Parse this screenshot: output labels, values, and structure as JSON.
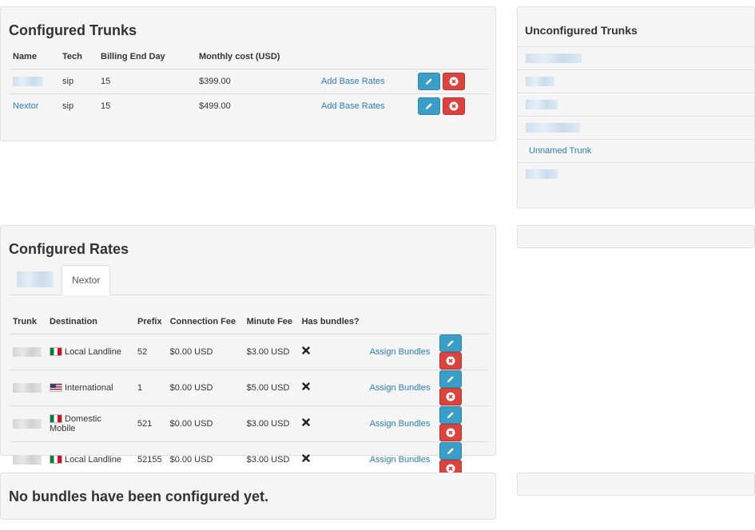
{
  "configured_trunks": {
    "title": "Configured Trunks",
    "columns": [
      "Name",
      "Tech",
      "Billing End Day",
      "Monthly cost (USD)"
    ],
    "rows": [
      {
        "name": "",
        "tech": "sip",
        "billing_end_day": "15",
        "monthly_cost": "$399.00",
        "action": "Add Base Rates"
      },
      {
        "name": "Nextor",
        "tech": "sip",
        "billing_end_day": "15",
        "monthly_cost": "$499.00",
        "action": "Add Base Rates"
      }
    ]
  },
  "unconfigured_trunks": {
    "title": "Unconfigured Trunks",
    "items": [
      "",
      "",
      "",
      "",
      "Unnamed Trunk",
      ""
    ]
  },
  "configured_rates": {
    "title": "Configured Rates",
    "tabs": [
      "",
      "Nextor"
    ],
    "active_tab": "Nextor",
    "columns": [
      "Trunk",
      "Destination",
      "Prefix",
      "Connection Fee",
      "Minute Fee",
      "Has bundles?"
    ],
    "rows": [
      {
        "trunk": "",
        "flag": "mx",
        "destination": "Local Landline",
        "prefix": "52",
        "connection_fee": "$0.00 USD",
        "minute_fee": "$3.00 USD",
        "has_bundles": "✖",
        "action": "Assign Bundles"
      },
      {
        "trunk": "",
        "flag": "us",
        "destination": "International",
        "prefix": "1",
        "connection_fee": "$0.00 USD",
        "minute_fee": "$5.00 USD",
        "has_bundles": "✖",
        "action": "Assign Bundles"
      },
      {
        "trunk": "",
        "flag": "mx",
        "destination": "Domestic Mobile",
        "prefix": "521",
        "connection_fee": "$0.00 USD",
        "minute_fee": "$3.00 USD",
        "has_bundles": "✖",
        "action": "Assign Bundles"
      },
      {
        "trunk": "",
        "flag": "mx",
        "destination": "Local Landline",
        "prefix": "52155",
        "connection_fee": "$0.00 USD",
        "minute_fee": "$3.00 USD",
        "has_bundles": "✖",
        "action": "Assign Bundles"
      }
    ]
  },
  "bundles": {
    "empty_message": "No bundles have been configured yet."
  },
  "colors": {
    "link": "#2a7db8",
    "edit_button": "#3a9ec6",
    "delete_button": "#d9443f",
    "panel_bg": "#f5f5f5"
  },
  "icons": {
    "edit": "pencil-icon",
    "delete": "times-circle-icon",
    "no_bundles": "cross-icon"
  }
}
